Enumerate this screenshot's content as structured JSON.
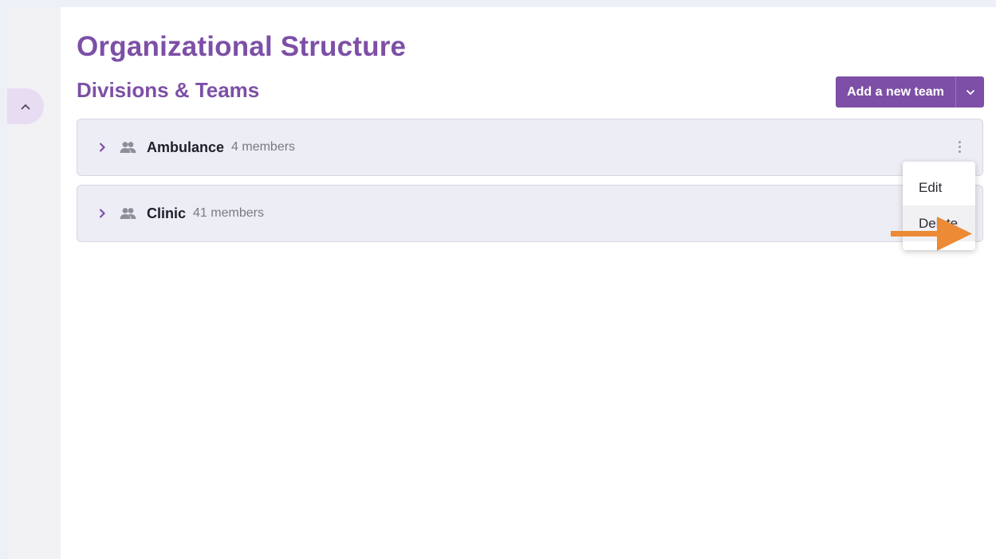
{
  "page": {
    "title": "Organizational Structure",
    "section_title": "Divisions & Teams"
  },
  "toolbar": {
    "add_team_label": "Add a new team"
  },
  "teams": [
    {
      "name": "Ambulance",
      "members": "4 members"
    },
    {
      "name": "Clinic",
      "members": "41 members"
    }
  ],
  "menu": {
    "items": [
      {
        "label": "Edit"
      },
      {
        "label": "Delete"
      }
    ]
  },
  "icons": {
    "collapse": "chevron-up-icon",
    "expand": "chevron-right-icon",
    "team": "people-icon",
    "more": "kebab-icon",
    "caret": "chevron-down-icon",
    "pointer": "arrow-right-icon"
  },
  "colors": {
    "brand": "#7d4fa6",
    "row_background": "#ededf5",
    "annotation_arrow": "#ec8a35"
  }
}
